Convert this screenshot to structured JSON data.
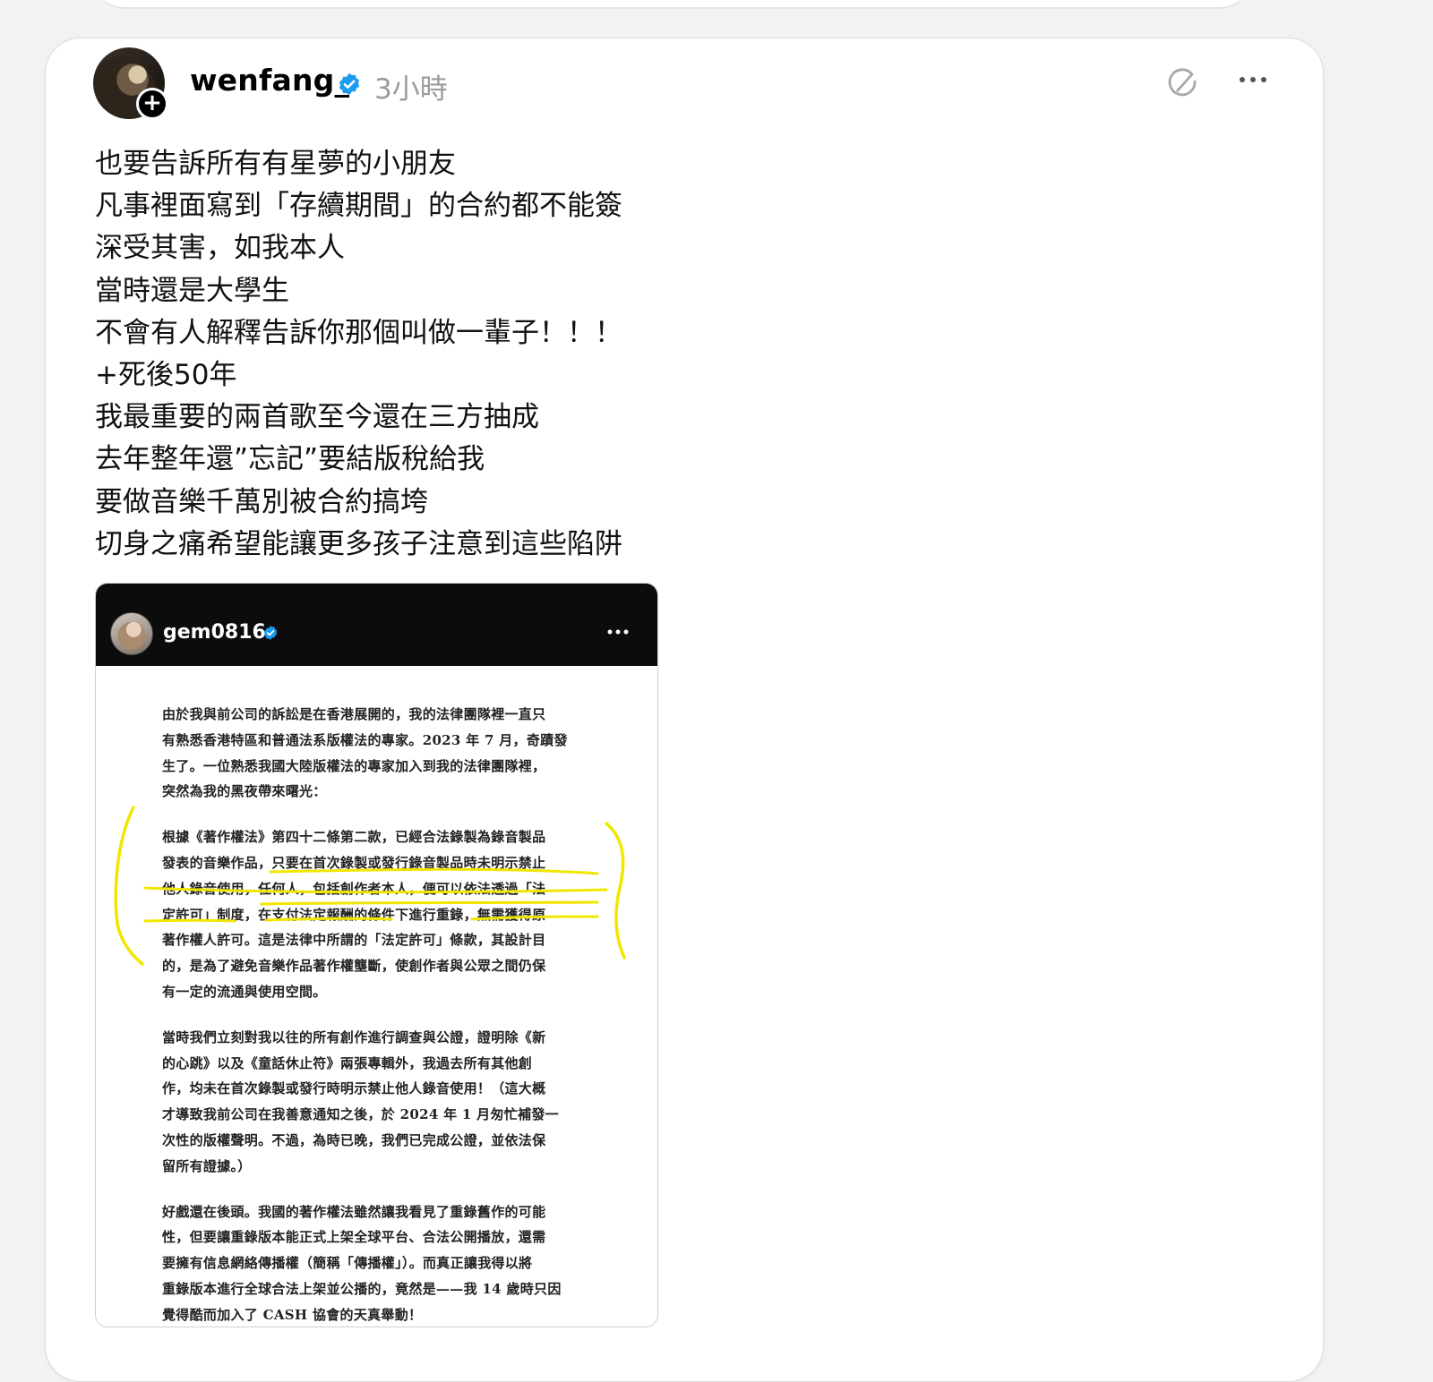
{
  "post": {
    "username": "wenfang_",
    "time": "3小時",
    "lines": [
      "也要告訴所有有星夢的小朋友",
      "凡事裡面寫到「存續期間」的合約都不能簽",
      "深受其害，如我本人",
      "當時還是大學生",
      "不會有人解釋告訴你那個叫做一輩子！！！",
      "+死後50年",
      "我最重要的兩首歌至今還￼在三方抽成",
      "￼去年整年還”忘記”要結版稅給我",
      "￼要做音樂千萬別被合約搞垮",
      "切身之痛希望能讓更多孩子注意到這些陷阱"
    ]
  },
  "screenshot": {
    "username": "gem0816",
    "paragraphs": [
      [
        "由於我與前公司的訴訟是在香港展開的，我的法律團隊裡一直只",
        "有熟悉香港特區和普通法系版權法的專家。2023 年 7 月，奇蹟發",
        "生了。一位熟悉我國大陸版權法的專家加入到我的法律團隊裡，",
        "突然為我的黑夜帶來曙光："
      ],
      [
        "根據《著作權法》第四十二條第二款，已經合法錄製為錄音製品",
        "發表的音樂作品，只要在首次錄製或發行錄音製品時未明示禁止",
        "他人錄音使用，任何人，包括創作者本人，便可以依法透過「法",
        "定許可」制度，在支付法定報酬的條件下進行重錄，無需獲得原",
        "著作權人許可。這是法律中所謂的「法定許可」條款，其設計目",
        "的，是為了避免音樂作品著作權壟斷，使創作者與公眾之間仍保",
        "有一定的流通與使用空間。"
      ],
      [
        "當時我們立刻對我以往的所有創作進行調查與公證，證明除《新",
        "的心跳》以及《童話休止符》兩張專輯外，我過去所有其他創",
        "作，均未在首次錄製或發行時明示禁止他人錄音使用！（這大概",
        "才導致我前公司在我善意通知之後，於 2024 年 1 月匆忙補發一",
        "次性的版權聲明。不過，為時已晚，我們已完成公證，並依法保",
        "留所有證據。）"
      ],
      [
        "好戲還在後頭。我國的著作權法雖然讓我看見了重錄舊作的可能",
        "性，但要讓重錄版本能正式上架全球平台、合法公開播放，還需",
        "要擁有信息網絡傳播權（簡稱「傳播權」）。而真正讓我得以將",
        "重錄版本進行全球合法上架並公播的，竟然是——我 14 歲時只因",
        "覺得酷而加入了 CASH 協會的天真舉動！"
      ]
    ]
  },
  "icons": {
    "verified": "verified-badge-icon",
    "edit": "edit-icon",
    "more": "more-icon",
    "follow": "plus-icon"
  },
  "colors": {
    "verified": "#1d9bf0",
    "highlight": "#f2e600",
    "time": "#9b9b9b"
  }
}
